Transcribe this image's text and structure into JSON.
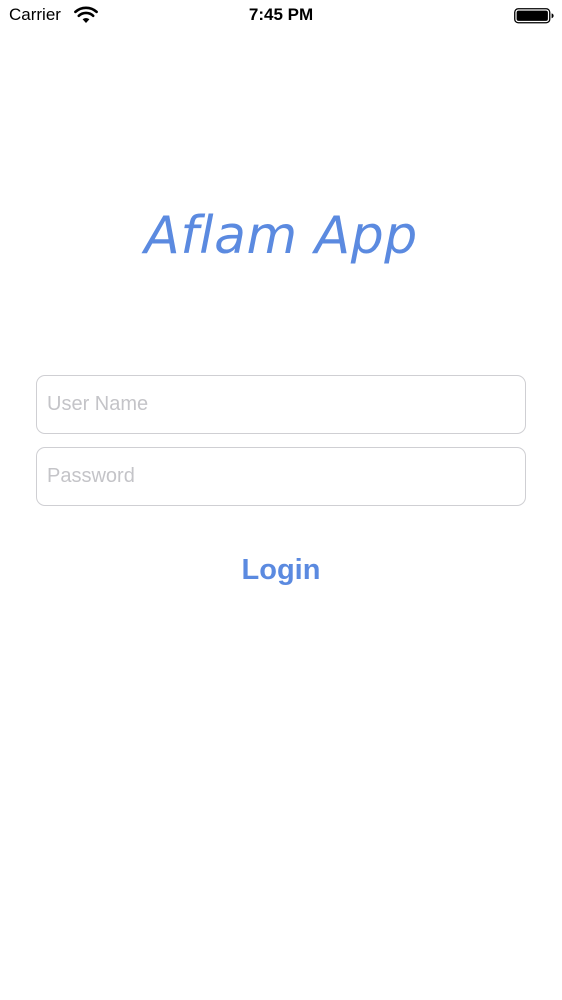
{
  "status_bar": {
    "carrier": "Carrier",
    "time": "7:45 PM",
    "icons": [
      "wifi-icon",
      "battery-icon"
    ]
  },
  "app": {
    "title": "Aflam App"
  },
  "login_form": {
    "username": {
      "value": "",
      "placeholder": "User Name"
    },
    "password": {
      "value": "",
      "placeholder": "Password"
    },
    "login_label": "Login"
  },
  "colors": {
    "accent": "#5b8ae0",
    "placeholder": "#c4c4c8",
    "field_border": "#cfcfd3",
    "background": "#ffffff"
  }
}
